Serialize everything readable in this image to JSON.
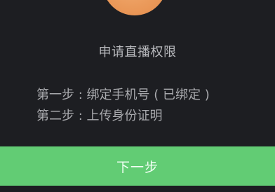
{
  "title": "申请直播权限",
  "steps": [
    "第一步 : 绑定手机号 ( 已绑定 )",
    "第二步 : 上传身份证明"
  ],
  "next_button": "下一步",
  "colors": {
    "background": "#1d1e22",
    "button": "#62cc74",
    "avatar": "#eb9b5c"
  }
}
